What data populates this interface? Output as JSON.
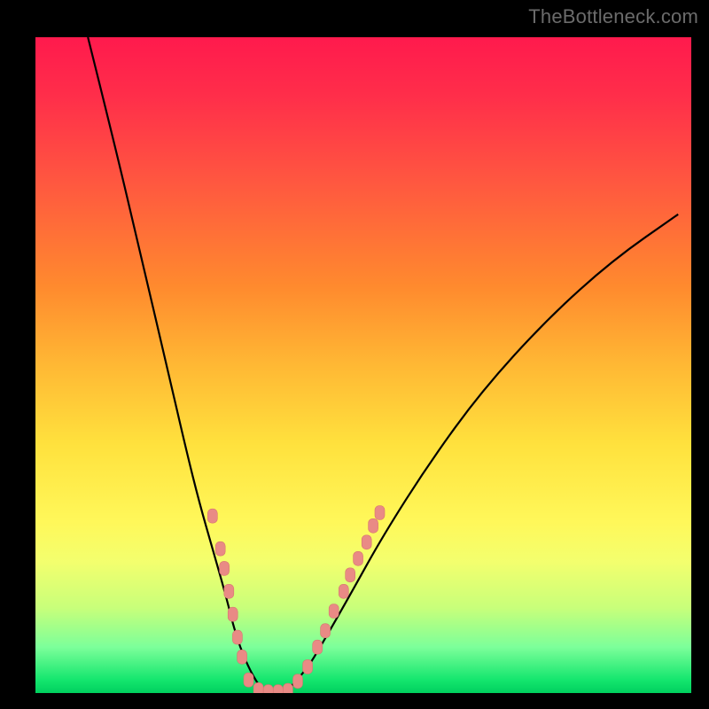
{
  "watermark": "TheBottleneck.com",
  "chart_data": {
    "type": "line",
    "title": "",
    "xlabel": "",
    "ylabel": "",
    "xlim": [
      0,
      100
    ],
    "ylim": [
      0,
      100
    ],
    "grid": false,
    "legend": false,
    "series": [
      {
        "name": "left-curve",
        "x": [
          8,
          12,
          16,
          20,
          23,
          25,
          27,
          29,
          30.5,
          32,
          33.5,
          35
        ],
        "y": [
          100,
          84,
          67,
          50,
          37,
          29,
          22,
          15,
          9,
          5,
          2,
          0
        ]
      },
      {
        "name": "right-curve",
        "x": [
          38,
          41,
          44,
          48,
          53,
          60,
          68,
          78,
          88,
          98
        ],
        "y": [
          0,
          3,
          8,
          15,
          24,
          35,
          46,
          57,
          66,
          73
        ]
      }
    ],
    "markers": [
      {
        "name": "left-markers",
        "points": [
          {
            "x": 27.0,
            "y": 27.0
          },
          {
            "x": 28.2,
            "y": 22.0
          },
          {
            "x": 28.8,
            "y": 19.0
          },
          {
            "x": 29.5,
            "y": 15.5
          },
          {
            "x": 30.1,
            "y": 12.0
          },
          {
            "x": 30.8,
            "y": 8.5
          },
          {
            "x": 31.5,
            "y": 5.5
          },
          {
            "x": 32.5,
            "y": 2.0
          },
          {
            "x": 34.0,
            "y": 0.5
          },
          {
            "x": 35.5,
            "y": 0.2
          },
          {
            "x": 37.0,
            "y": 0.2
          }
        ]
      },
      {
        "name": "right-markers",
        "points": [
          {
            "x": 38.5,
            "y": 0.4
          },
          {
            "x": 40.0,
            "y": 1.8
          },
          {
            "x": 41.5,
            "y": 4.0
          },
          {
            "x": 43.0,
            "y": 7.0
          },
          {
            "x": 44.2,
            "y": 9.5
          },
          {
            "x": 45.5,
            "y": 12.5
          },
          {
            "x": 47.0,
            "y": 15.5
          },
          {
            "x": 48.0,
            "y": 18.0
          },
          {
            "x": 49.2,
            "y": 20.5
          },
          {
            "x": 50.5,
            "y": 23.0
          },
          {
            "x": 51.5,
            "y": 25.5
          },
          {
            "x": 52.5,
            "y": 27.5
          }
        ]
      }
    ],
    "colors": {
      "curve": "#000000",
      "marker_fill": "#e98a85",
      "marker_stroke": "#d87670",
      "background_top": "#ff1a4d",
      "background_bottom": "#00d05e"
    }
  }
}
